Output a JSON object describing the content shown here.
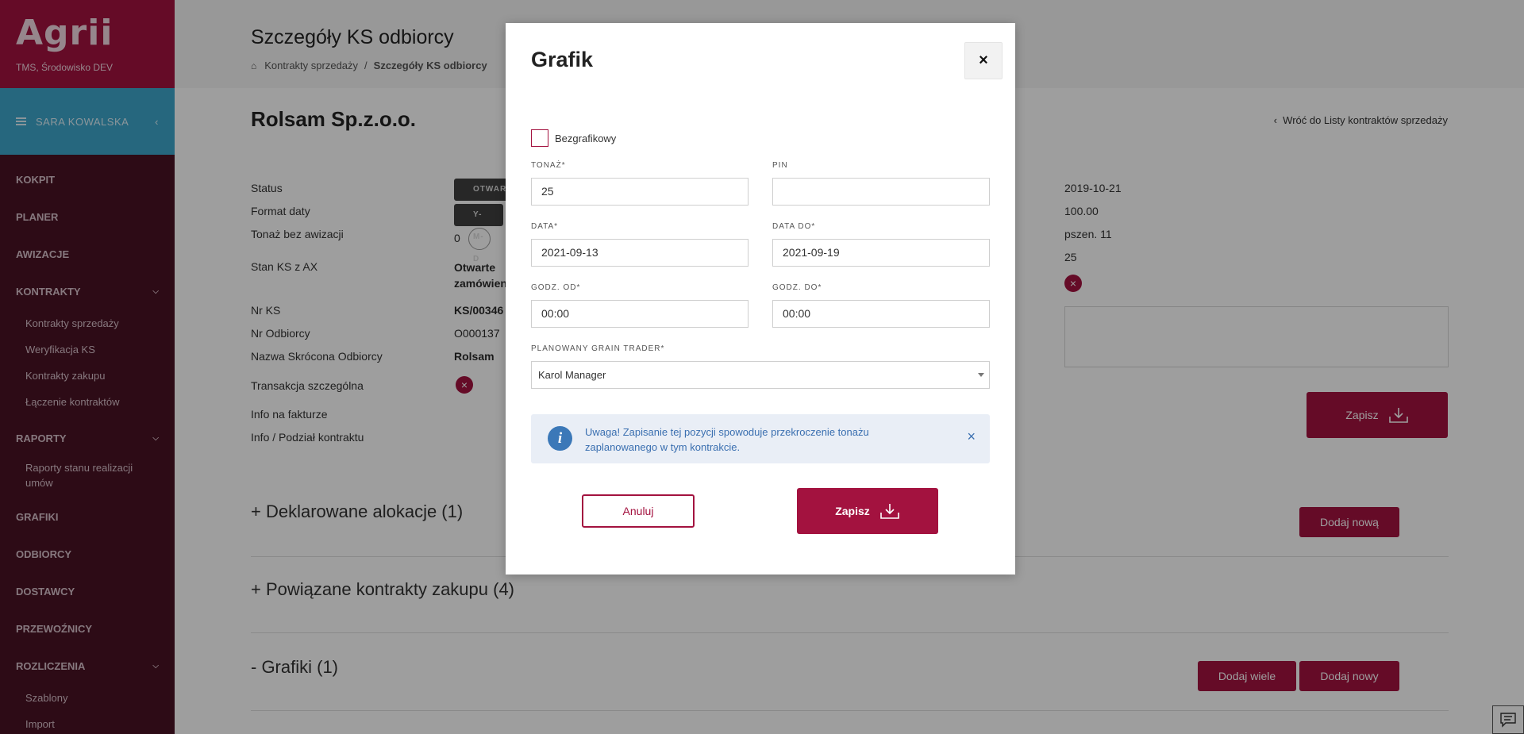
{
  "app": {
    "logo": "Agrii",
    "environment": "TMS, Środowisko DEV"
  },
  "user": {
    "name": "SARA KOWALSKA"
  },
  "sidebar": {
    "items": [
      {
        "label": "KOKPIT"
      },
      {
        "label": "PLANER"
      },
      {
        "label": "AWIZACJE"
      },
      {
        "label": "KONTRAKTY",
        "sub": [
          "Kontrakty sprzedaży",
          "Weryfikacja KS",
          "Kontrakty zakupu",
          "Łączenie kontraktów"
        ]
      },
      {
        "label": "RAPORTY",
        "sub": [
          "Raporty stanu realizacji umów"
        ]
      },
      {
        "label": "GRAFIKI"
      },
      {
        "label": "ODBIORCY"
      },
      {
        "label": "DOSTAWCY"
      },
      {
        "label": "PRZEWOŹNICY"
      },
      {
        "label": "ROZLICZENIA",
        "sub": [
          "Szablony",
          "Import"
        ]
      }
    ]
  },
  "header": {
    "title": "Szczegóły KS odbiorcy",
    "breadcrumb": [
      "Kontrakty sprzedaży",
      "Szczegóły KS odbiorcy"
    ]
  },
  "page": {
    "company": "Rolsam Sp.z.o.o.",
    "back_link": "Wróć do Listy kontraktów sprzedaży",
    "labels": [
      "Status",
      "Format daty",
      "Tonaż bez awizacji",
      "Stan KS z AX",
      "Nr KS",
      "Nr Odbiorcy",
      "Nazwa Skrócona Odbiorcy",
      "Transakcja szczególna",
      "Info na fakturze",
      "Info / Podział kontraktu"
    ],
    "status_pill": "OTWAR",
    "format_pill": "Y-M-D",
    "tonnage_value": "0",
    "stan_ks": "Otwarte",
    "stan_ks_2": "zamówien",
    "nr_ks": "KS/00346",
    "nr_odbiorcy": "O000137",
    "nazwa": "Rolsam",
    "right_values": [
      "2019-10-21",
      "100.00",
      "pszen. 11",
      "25"
    ],
    "save_label": "Zapisz",
    "sections": [
      {
        "title": "+ Deklarowane alokacje (1)",
        "buttons": [
          "Dodaj nową"
        ]
      },
      {
        "title": "+ Powiązane kontrakty zakupu (4)",
        "buttons": []
      },
      {
        "title": "- Grafiki (1)",
        "buttons": [
          "Dodaj wiele",
          "Dodaj nowy"
        ]
      }
    ]
  },
  "modal": {
    "title": "Grafik",
    "close": "×",
    "checkbox_label": "Bezgrafikowy",
    "fields": {
      "tonaz": {
        "label": "TONAŻ*",
        "value": "25"
      },
      "pin": {
        "label": "PIN",
        "value": ""
      },
      "data": {
        "label": "DATA*",
        "value": "2021-09-13"
      },
      "data_do": {
        "label": "DATA DO*",
        "value": "2021-09-19"
      },
      "godz_od": {
        "label": "GODZ. OD*",
        "value": "00:00"
      },
      "godz_do": {
        "label": "GODZ. DO*",
        "value": "00:00"
      },
      "trader": {
        "label": "PLANOWANY GRAIN TRADER*",
        "value": "Karol Manager"
      }
    },
    "alert": {
      "text": "Uwaga! Zapisanie tej pozycji spowoduje przekroczenie tonażu zaplanowanego w tym kontrakcie.",
      "close": "×"
    },
    "cancel_label": "Anuluj",
    "save_label": "Zapisz"
  }
}
